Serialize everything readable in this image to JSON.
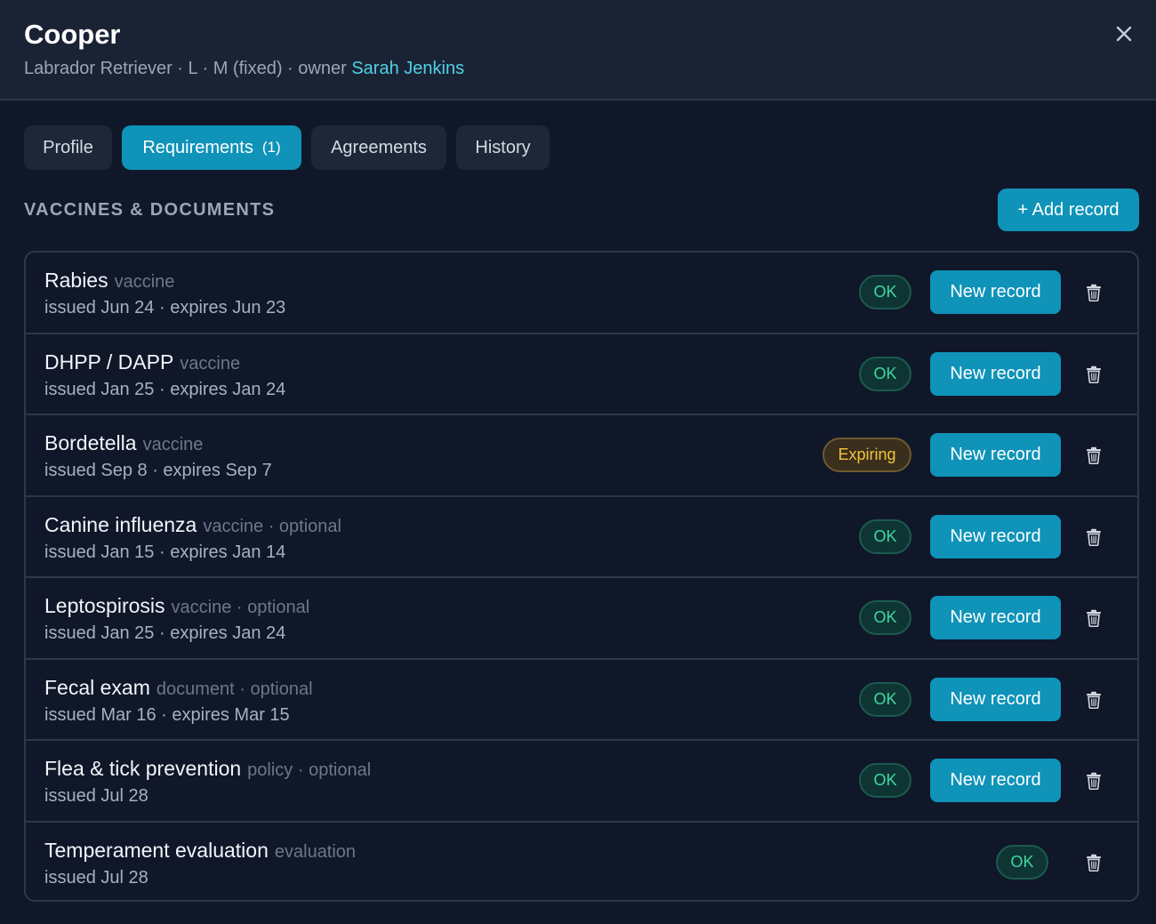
{
  "header": {
    "name": "Cooper",
    "breed": "Labrador Retriever",
    "size": "L",
    "sex": "M (fixed)",
    "owner_prefix": "owner",
    "owner_name": "Sarah Jenkins",
    "separator": " · ",
    "close_icon": "close-icon"
  },
  "tabs": [
    {
      "label": "Profile",
      "count": ""
    },
    {
      "label": "Requirements",
      "count": "(1)"
    },
    {
      "label": "Agreements",
      "count": ""
    },
    {
      "label": "History",
      "count": ""
    }
  ],
  "active_tab": "Requirements",
  "section": {
    "title": "VACCINES & DOCUMENTS",
    "add_button": "+ Add record"
  },
  "records": [
    {
      "name": "Rabies",
      "tags": "vaccine",
      "dates": "issued Jun 24 · expires Jun 23",
      "status": "OK",
      "action": "New record"
    },
    {
      "name": "DHPP / DAPP",
      "tags": "vaccine",
      "dates": "issued Jan 25 · expires Jan 24",
      "status": "OK",
      "action": "New record"
    },
    {
      "name": "Bordetella",
      "tags": "vaccine",
      "dates": "issued Sep 8 · expires Sep 7",
      "status": "Expiring",
      "action": "New record"
    },
    {
      "name": "Canine influenza",
      "tags": "vaccine · optional",
      "dates": "issued Jan 15 · expires Jan 14",
      "status": "OK",
      "action": "New record"
    },
    {
      "name": "Leptospirosis",
      "tags": "vaccine · optional",
      "dates": "issued Jan 25 · expires Jan 24",
      "status": "OK",
      "action": "New record"
    },
    {
      "name": "Fecal exam",
      "tags": "document · optional",
      "dates": "issued Mar 16 · expires Mar 15",
      "status": "OK",
      "action": "New record"
    },
    {
      "name": "Flea & tick prevention",
      "tags": "policy · optional",
      "dates": "issued Jul 28",
      "status": "OK",
      "action": "New record"
    },
    {
      "name": "Temperament evaluation",
      "tags": "evaluation",
      "dates": "issued Jul 28",
      "status": "OK",
      "action": ""
    }
  ],
  "colors": {
    "background": "#0f1729",
    "header": "#1a2334",
    "accent": "#0f93b8",
    "link": "#4fd1e8",
    "ok": "#3ed8a0",
    "warning": "#f3c23e"
  }
}
